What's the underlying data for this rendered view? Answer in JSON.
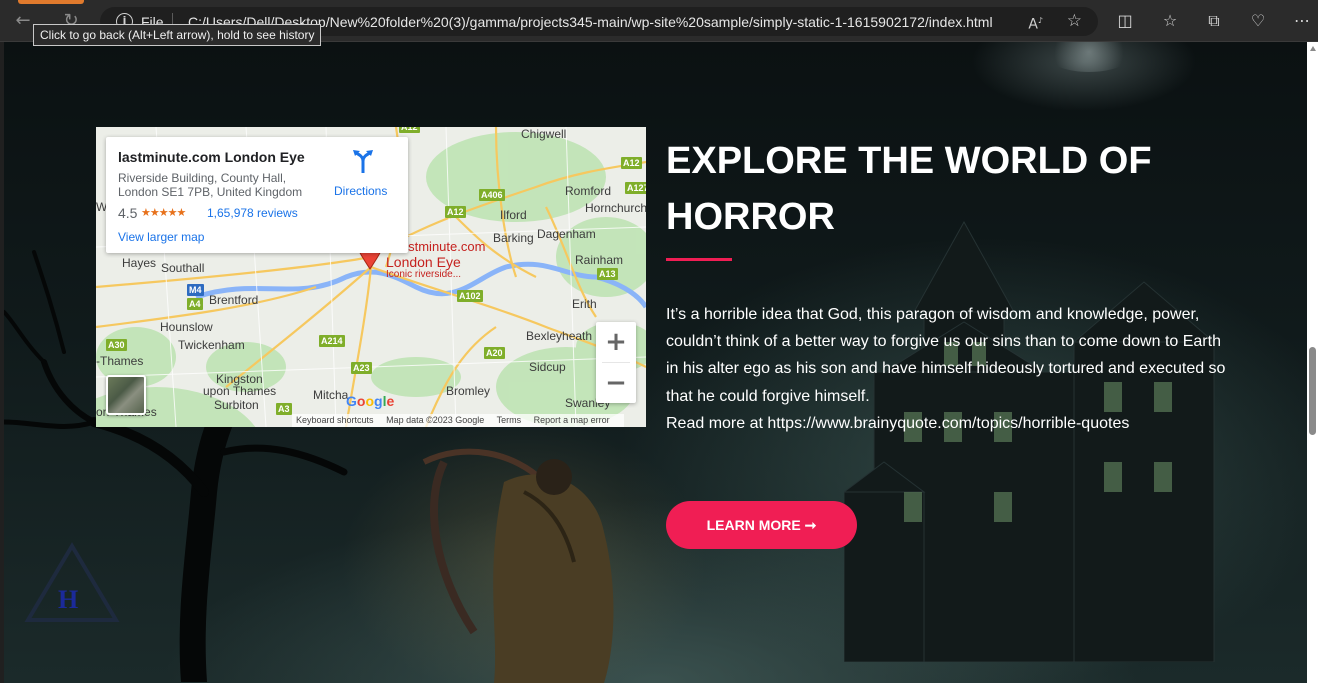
{
  "browser": {
    "scheme_label": "File",
    "url": "C:/Users/Dell/Desktop/New%20folder%20(3)/gamma/projects345-main/wp-site%20sample/simply-static-1-1615902172/index.html",
    "read_aloud_label": "A",
    "tooltip": "Click to go back (Alt+Left arrow), hold to see history",
    "icons": [
      "back-arrow-icon",
      "refresh-icon",
      "info-icon",
      "read-aloud-icon",
      "favorite-star-icon",
      "split-screen-icon",
      "favorites-icon",
      "collections-icon",
      "browser-essentials-icon",
      "more-icon"
    ]
  },
  "map": {
    "card": {
      "name": "lastminute.com London Eye",
      "address_line1": "Riverside Building, County Hall,",
      "address_line2": "London SE1 7PB, United Kingdom",
      "rating": "4.5",
      "stars": "★★★★★",
      "reviews": "1,65,978 reviews",
      "larger_map": "View larger map",
      "directions": "Directions"
    },
    "pin": {
      "line1": "lastminute.com",
      "line2": "London Eye",
      "line3": "Iconic riverside..."
    },
    "places": {
      "chigwell": "Chigwell",
      "romford": "Romford",
      "hornchurch": "Hornchurch",
      "ilford": "Ilford",
      "barking": "Barking",
      "dagenham": "Dagenham",
      "rainham": "Rainham",
      "erith": "Erith",
      "hayes": "Hayes",
      "southall": "Southall",
      "brentford": "Brentford",
      "hounslow": "Hounslow",
      "twickenham": "Twickenham",
      "kingston": "Kingston",
      "upon_thames": "upon Thames",
      "surbiton": "Surbiton",
      "thames_left": "-Thames",
      "on_thames": "on-Thames",
      "bexleyheath": "Bexleyheath",
      "sidcup": "Sidcup",
      "bromley": "Bromley",
      "mitcham": "Mitcha",
      "swanley": "Swanley",
      "wa": "Wa"
    },
    "roads": {
      "a12_top": "A12",
      "a127": "A127",
      "a406": "A406",
      "a12_mid": "A12",
      "a13": "A13",
      "a102": "A102",
      "m4": "M4",
      "a4": "A4",
      "a30": "A30",
      "a214": "A214",
      "a20": "A20",
      "a23": "A23",
      "a3": "A3"
    },
    "zoom_in": "+",
    "zoom_out": "−",
    "google_logo": "Google",
    "attribution": {
      "shortcuts": "Keyboard shortcuts",
      "data": "Map data ©2023 Google",
      "terms": "Terms",
      "report": "Report a map error"
    }
  },
  "hero": {
    "heading": "EXPLORE THE WORLD OF HORROR",
    "body": "It’s a horrible idea that God, this paragon of wisdom and knowledge, power, couldn’t think of a better way to forgive us our sins than to come down to Earth in his alter ego as his son and have himself hideously tortured and executed so that he could forgive himself.",
    "read_more": "Read more at https://www.brainyquote.com/topics/horrible-quotes",
    "cta_label": "LEARN MORE ➞",
    "accent_color": "#f01e54"
  }
}
